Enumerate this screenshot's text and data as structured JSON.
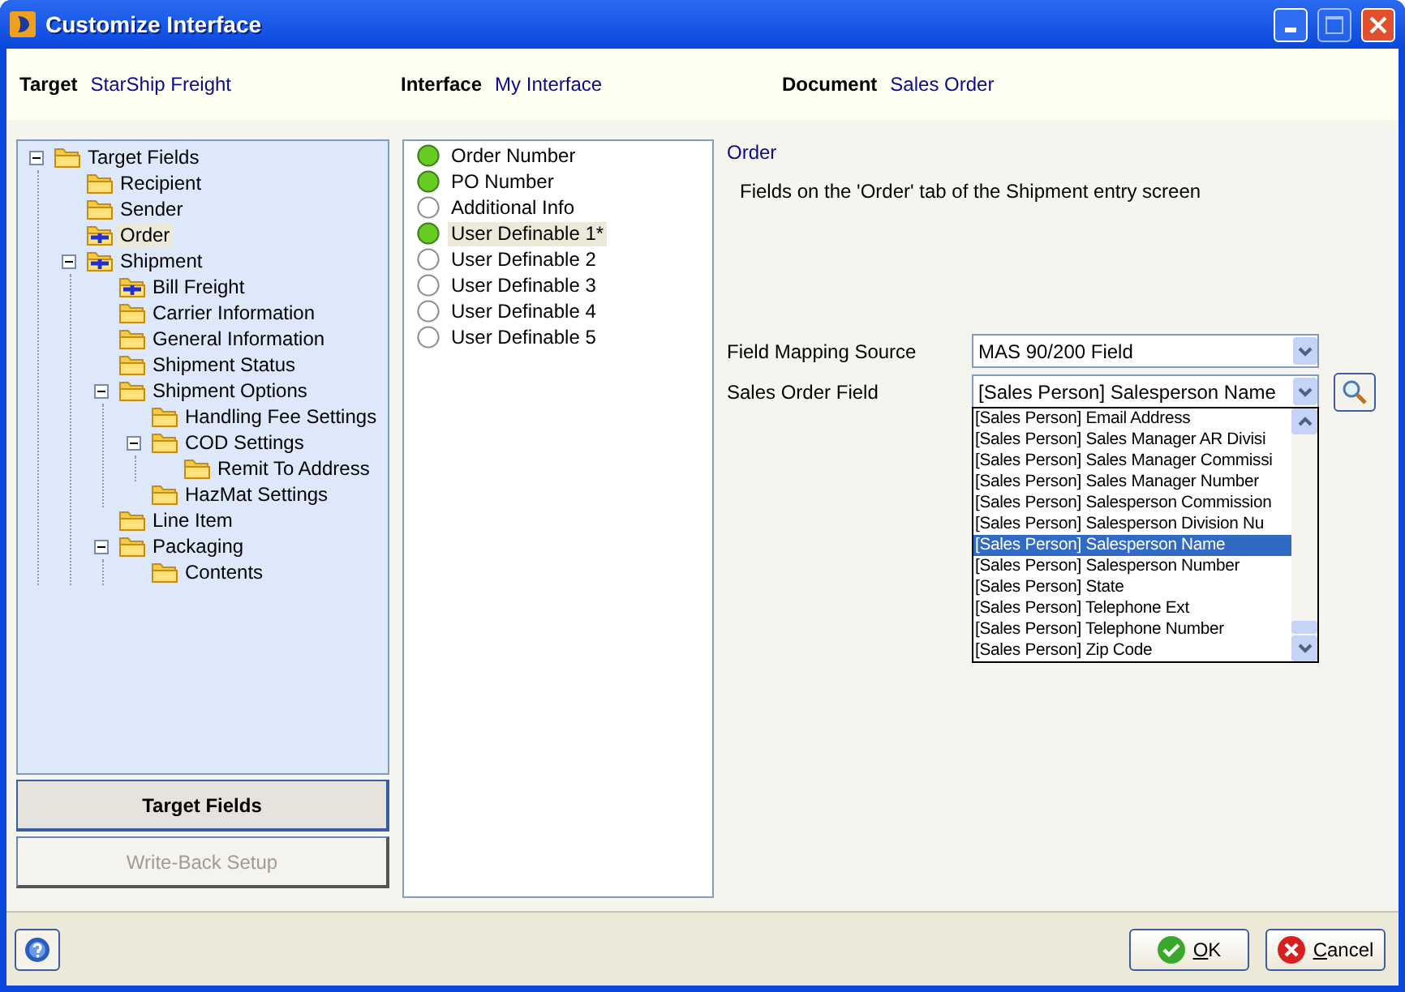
{
  "window": {
    "title": "Customize Interface"
  },
  "header": [
    {
      "label": "Target",
      "value": "StarShip Freight"
    },
    {
      "label": "Interface",
      "value": "My Interface"
    },
    {
      "label": "Document",
      "value": "Sales Order"
    }
  ],
  "tree": [
    {
      "label": "Target Fields",
      "mapped": false,
      "selected": false,
      "expanded": true,
      "children": [
        {
          "label": "Recipient",
          "mapped": false,
          "selected": false
        },
        {
          "label": "Sender",
          "mapped": false,
          "selected": false
        },
        {
          "label": "Order",
          "mapped": true,
          "selected": true
        },
        {
          "label": "Shipment",
          "mapped": true,
          "selected": false,
          "expanded": true,
          "children": [
            {
              "label": "Bill Freight",
              "mapped": true,
              "selected": false
            },
            {
              "label": "Carrier Information",
              "mapped": false,
              "selected": false
            },
            {
              "label": "General Information",
              "mapped": false,
              "selected": false
            },
            {
              "label": "Shipment Status",
              "mapped": false,
              "selected": false
            },
            {
              "label": "Shipment Options",
              "mapped": false,
              "selected": false,
              "expanded": true,
              "children": [
                {
                  "label": "Handling Fee Settings",
                  "mapped": false,
                  "selected": false
                },
                {
                  "label": "COD Settings",
                  "mapped": false,
                  "selected": false,
                  "expanded": true,
                  "children": [
                    {
                      "label": "Remit To Address",
                      "mapped": false,
                      "selected": false
                    }
                  ]
                },
                {
                  "label": "HazMat Settings",
                  "mapped": false,
                  "selected": false
                }
              ]
            },
            {
              "label": "Line Item",
              "mapped": false,
              "selected": false
            },
            {
              "label": "Packaging",
              "mapped": false,
              "selected": false,
              "expanded": true,
              "children": [
                {
                  "label": "Contents",
                  "mapped": false,
                  "selected": false
                }
              ]
            }
          ]
        }
      ]
    }
  ],
  "nav_buttons": [
    {
      "label": "Target Fields",
      "selected": true,
      "disabled": false
    },
    {
      "label": "Write-Back Setup",
      "selected": false,
      "disabled": true
    }
  ],
  "fields": [
    {
      "label": "Order Number",
      "mapped": true,
      "selected": false
    },
    {
      "label": "PO Number",
      "mapped": true,
      "selected": false
    },
    {
      "label": "Additional Info",
      "mapped": false,
      "selected": false
    },
    {
      "label": "User Definable 1*",
      "mapped": true,
      "selected": true
    },
    {
      "label": "User Definable 2",
      "mapped": false,
      "selected": false
    },
    {
      "label": "User Definable 3",
      "mapped": false,
      "selected": false
    },
    {
      "label": "User Definable 4",
      "mapped": false,
      "selected": false
    },
    {
      "label": "User Definable 5",
      "mapped": false,
      "selected": false
    }
  ],
  "detail": {
    "heading": "Order",
    "description": "Fields on the 'Order' tab of the Shipment entry screen",
    "mapping_source": {
      "label": "Field Mapping Source",
      "value": "MAS 90/200 Field"
    },
    "sales_order_field": {
      "label": "Sales Order Field",
      "value": "[Sales Person] Salesperson Name",
      "expanded": true,
      "options": [
        {
          "label": "[Sales Person] Email Address",
          "selected": false
        },
        {
          "label": "[Sales Person] Sales Manager AR Divisi",
          "selected": false
        },
        {
          "label": "[Sales Person] Sales Manager Commissi",
          "selected": false
        },
        {
          "label": "[Sales Person] Sales Manager Number",
          "selected": false
        },
        {
          "label": "[Sales Person] Salesperson Commission",
          "selected": false
        },
        {
          "label": "[Sales Person] Salesperson Division Nu",
          "selected": false
        },
        {
          "label": "[Sales Person] Salesperson Name",
          "selected": true
        },
        {
          "label": "[Sales Person] Salesperson Number",
          "selected": false
        },
        {
          "label": "[Sales Person] State",
          "selected": false
        },
        {
          "label": "[Sales Person] Telephone Ext",
          "selected": false
        },
        {
          "label": "[Sales Person] Telephone Number",
          "selected": false
        },
        {
          "label": "[Sales Person] Zip Code",
          "selected": false
        }
      ]
    }
  },
  "buttons": [
    {
      "kind": "ok",
      "label": "OK"
    },
    {
      "kind": "cancel",
      "label": "Cancel"
    }
  ]
}
